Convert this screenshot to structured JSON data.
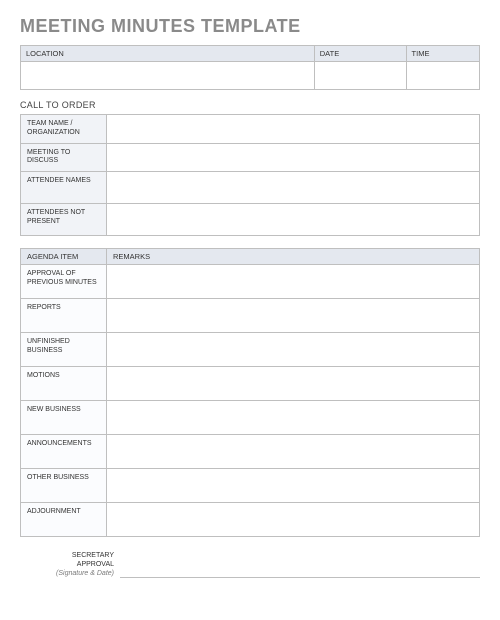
{
  "title": "MEETING MINUTES TEMPLATE",
  "info_header": {
    "location_label": "LOCATION",
    "date_label": "DATE",
    "time_label": "TIME",
    "location_value": "",
    "date_value": "",
    "time_value": ""
  },
  "call_to_order": {
    "heading": "CALL TO ORDER",
    "rows": [
      {
        "label": "TEAM NAME / ORGANIZATION",
        "value": ""
      },
      {
        "label": "MEETING TO DISCUSS",
        "value": ""
      },
      {
        "label": "ATTENDEE NAMES",
        "value": ""
      },
      {
        "label": "ATTENDEES NOT PRESENT",
        "value": ""
      }
    ]
  },
  "agenda": {
    "col1": "AGENDA ITEM",
    "col2": "REMARKS",
    "rows": [
      {
        "label": "APPROVAL OF PREVIOUS MINUTES",
        "value": ""
      },
      {
        "label": "REPORTS",
        "value": ""
      },
      {
        "label": "UNFINISHED BUSINESS",
        "value": ""
      },
      {
        "label": "MOTIONS",
        "value": ""
      },
      {
        "label": "NEW BUSINESS",
        "value": ""
      },
      {
        "label": "ANNOUNCEMENTS",
        "value": ""
      },
      {
        "label": "OTHER BUSINESS",
        "value": ""
      },
      {
        "label": "ADJOURNMENT",
        "value": ""
      }
    ]
  },
  "signature": {
    "line1": "SECRETARY",
    "line2": "APPROVAL",
    "sub": "(Signature & Date)",
    "value": ""
  }
}
